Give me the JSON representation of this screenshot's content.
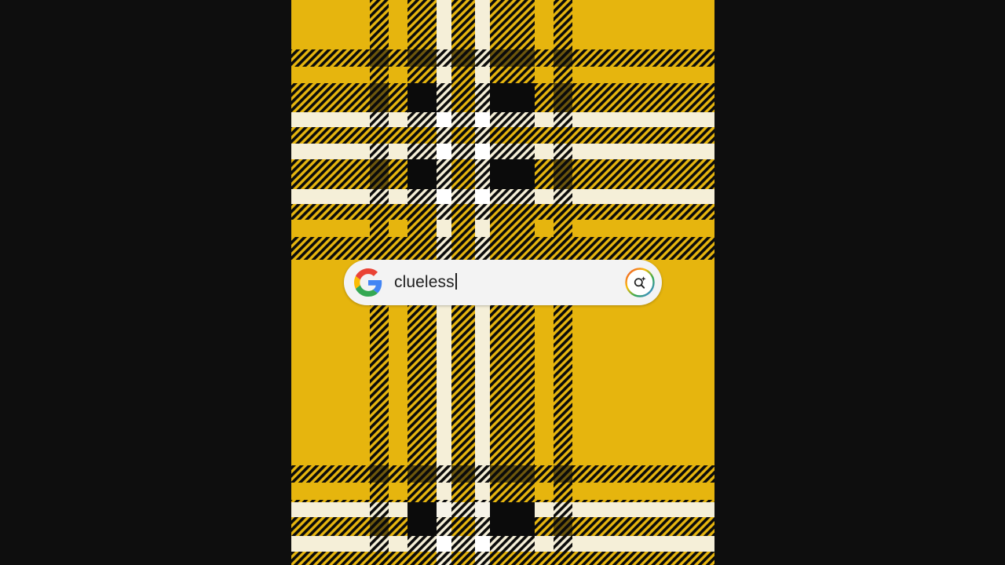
{
  "wallpaper": {
    "name": "yellow-plaid-wallpaper",
    "colors": {
      "yellow": "#e6b50e",
      "black": "#0b0b0b",
      "white": "#f7f4ea"
    }
  },
  "search": {
    "query": "clueless",
    "left_icon": "google-g-logo-icon",
    "right_icon": "ai-lens-search-icon",
    "brand_colors": [
      "#4285F4",
      "#EA4335",
      "#FBBC05",
      "#34A853"
    ]
  }
}
